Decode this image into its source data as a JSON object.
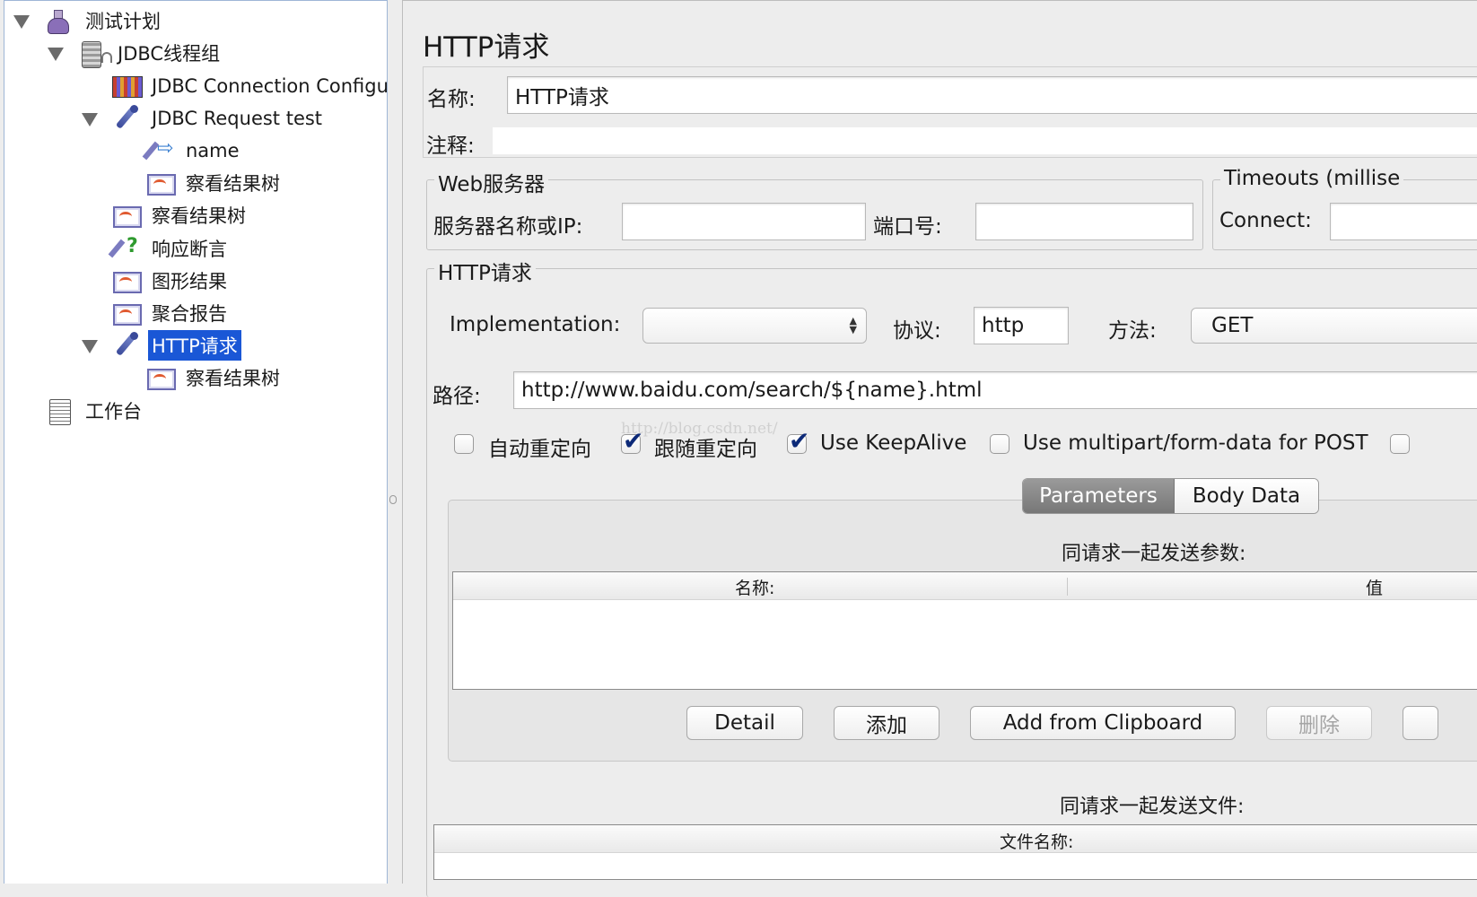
{
  "tree": {
    "items": [
      {
        "label": "测试计划",
        "icon": "flask-icon"
      },
      {
        "label": "JDBC线程组",
        "icon": "thread-group-icon"
      },
      {
        "label": "JDBC Connection Configu",
        "icon": "database-config-icon"
      },
      {
        "label": "JDBC Request test",
        "icon": "sampler-pipette-icon"
      },
      {
        "label": "name",
        "icon": "variable-extractor-icon"
      },
      {
        "label": "察看结果树",
        "icon": "listener-graph-icon"
      },
      {
        "label": "察看结果树",
        "icon": "listener-graph-icon"
      },
      {
        "label": "响应断言",
        "icon": "assertion-icon"
      },
      {
        "label": "图形结果",
        "icon": "listener-graph-icon"
      },
      {
        "label": "聚合报告",
        "icon": "listener-graph-icon"
      },
      {
        "label": "HTTP请求",
        "icon": "sampler-pipette-icon",
        "selected": true
      },
      {
        "label": "察看结果树",
        "icon": "listener-graph-icon"
      },
      {
        "label": "工作台",
        "icon": "workbench-clipboard-icon"
      }
    ]
  },
  "panel": {
    "title": "HTTP请求",
    "name_label": "名称:",
    "name_value": "HTTP请求",
    "comment_label": "注释:",
    "web_server": {
      "legend": "Web服务器",
      "server_label": "服务器名称或IP:",
      "server_value": "",
      "port_label": "端口号:",
      "port_value": ""
    },
    "timeouts": {
      "legend": "Timeouts (millise",
      "connect_label": "Connect:",
      "connect_value": ""
    },
    "http_request": {
      "legend": "HTTP请求",
      "implementation_label": "Implementation:",
      "implementation_value": "",
      "protocol_label": "协议:",
      "protocol_value": "http",
      "method_label": "方法:",
      "method_value": "GET",
      "path_label": "路径:",
      "path_value": "http://www.baidu.com/search/${name}.html"
    },
    "checkboxes": [
      {
        "label": "自动重定向",
        "checked": false
      },
      {
        "label": "跟随重定向",
        "checked": true
      },
      {
        "label": "Use KeepAlive",
        "checked": true
      },
      {
        "label": "Use multipart/form-data for POST",
        "checked": false
      }
    ],
    "tabs": [
      {
        "label": "Parameters",
        "active": true
      },
      {
        "label": "Body Data",
        "active": false
      }
    ],
    "params_caption": "同请求一起发送参数:",
    "table_headers": [
      "名称:",
      "值"
    ],
    "buttons": {
      "detail": "Detail",
      "add": "添加",
      "add_clipboard": "Add from Clipboard",
      "delete": "删除"
    },
    "files_caption": "同请求一起发送文件:",
    "files_header": "文件名称:"
  },
  "watermark": "http://blog.csdn.net/",
  "colors": {
    "selection": "#1a57d6",
    "check_mark": "#0d2a78",
    "panel_bg": "#ededed"
  }
}
